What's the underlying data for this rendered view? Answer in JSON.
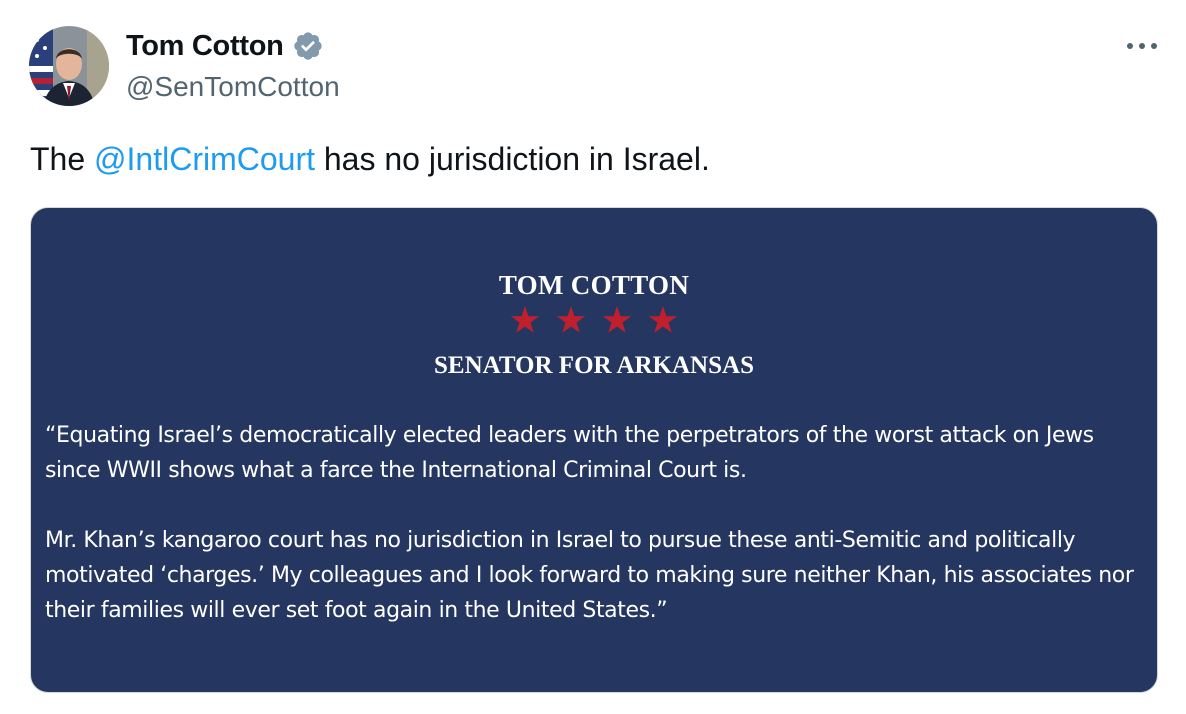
{
  "author": {
    "display_name": "Tom Cotton",
    "handle": "@SenTomCotton",
    "verified": true,
    "verified_color": "#829aab"
  },
  "tweet": {
    "text_before": "The ",
    "mention": "@IntlCrimCourt",
    "text_after": " has no jurisdiction in Israel.",
    "mention_color": "#1d9bf0"
  },
  "icons": {
    "more": "more-horizontal-icon",
    "verified": "verified-badge-icon"
  },
  "media": {
    "title": "TOM COTTON",
    "star_count": 4,
    "star_color": "#c0202d",
    "subtitle": "SENATOR FOR ARKANSAS",
    "background_color": "#253660",
    "paragraphs": [
      "“Equating Israel’s democratically elected leaders with the perpetrators of the worst attack on Jews since WWII shows what a farce the International Criminal Court is.",
      "Mr. Khan’s kangaroo court has no jurisdiction in Israel to pursue these anti-Semitic and politically motivated ‘charges.’ My colleagues and I look forward to making sure neither Khan, his associates nor their families will ever set foot again in the United States.”"
    ]
  }
}
